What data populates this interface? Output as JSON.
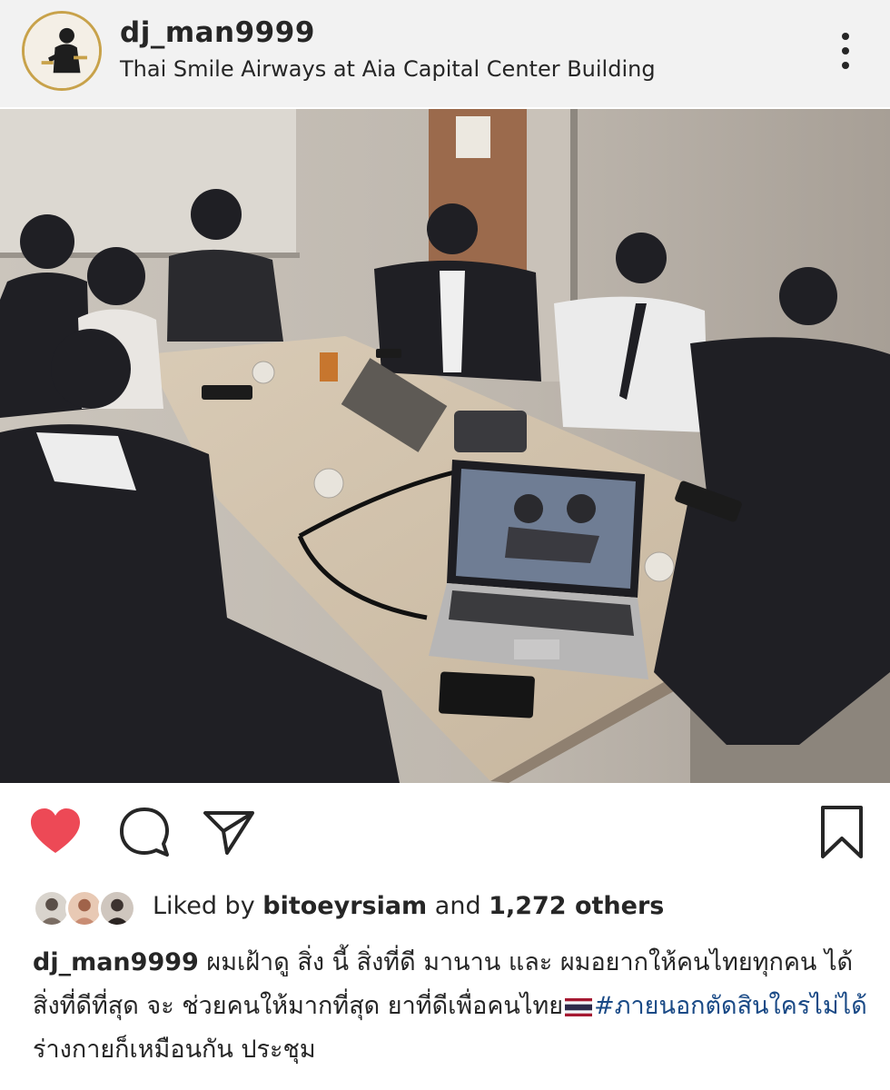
{
  "post": {
    "username": "dj_man9999",
    "location": "Thai Smile Airways at Aia Capital Center Building"
  },
  "icons": {
    "more": "more-vertical-icon",
    "like": "heart-icon",
    "comment": "comment-icon",
    "share": "send-icon",
    "save": "bookmark-icon"
  },
  "colors": {
    "like_red": "#ed4956",
    "hashtag_blue": "#1a4a86",
    "text": "#262626"
  },
  "likes": {
    "prefix": "Liked by ",
    "user": "bitoeyrsiam",
    "middle": " and ",
    "count": "1,272 others"
  },
  "caption": {
    "username": "dj_man9999",
    "text_1": " ผมเฝ้าดู สิ่ง นี้ สิ่งที่ดี มานาน และ ผมอยากให้คนไทยทุกคน ได้สิ่งที่ดีที่สุด จะ ช่วยคนให้มากที่สุด ยาที่ดีเพื่อคนไทย",
    "hashtag": "#ภายนอกตัดสินใครไม่ได้",
    "text_2": " ร่างกายก็เหมือนกัน ประชุม"
  }
}
